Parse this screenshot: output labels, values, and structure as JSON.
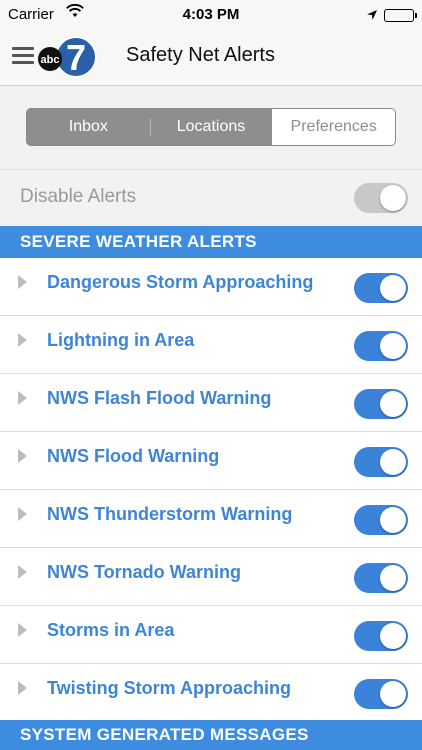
{
  "status_bar": {
    "carrier": "Carrier",
    "time": "4:03 PM"
  },
  "nav": {
    "logo_text": "abc",
    "logo_number": "7",
    "title": "Safety Net Alerts"
  },
  "tabs": [
    {
      "label": "Inbox",
      "active": false
    },
    {
      "label": "Locations",
      "active": false
    },
    {
      "label": "Preferences",
      "active": true
    }
  ],
  "disable_alerts": {
    "label": "Disable Alerts",
    "on": false
  },
  "sections": {
    "severe_weather": "SEVERE WEATHER ALERTS",
    "system_generated": "SYSTEM GENERATED MESSAGES"
  },
  "alerts": [
    {
      "label": "Dangerous Storm Approaching",
      "on": true
    },
    {
      "label": "Lightning in Area",
      "on": true
    },
    {
      "label": "NWS Flash Flood Warning",
      "on": true
    },
    {
      "label": "NWS Flood Warning",
      "on": true
    },
    {
      "label": "NWS Thunderstorm Warning",
      "on": true
    },
    {
      "label": "NWS Tornado Warning",
      "on": true
    },
    {
      "label": "Storms in Area",
      "on": true
    },
    {
      "label": "Twisting Storm Approaching",
      "on": true
    }
  ],
  "colors": {
    "accent": "#3e8ce0",
    "toggle_on": "#3b82d9",
    "toggle_off": "#c8c8c8",
    "alert_text": "#3e85d6"
  }
}
